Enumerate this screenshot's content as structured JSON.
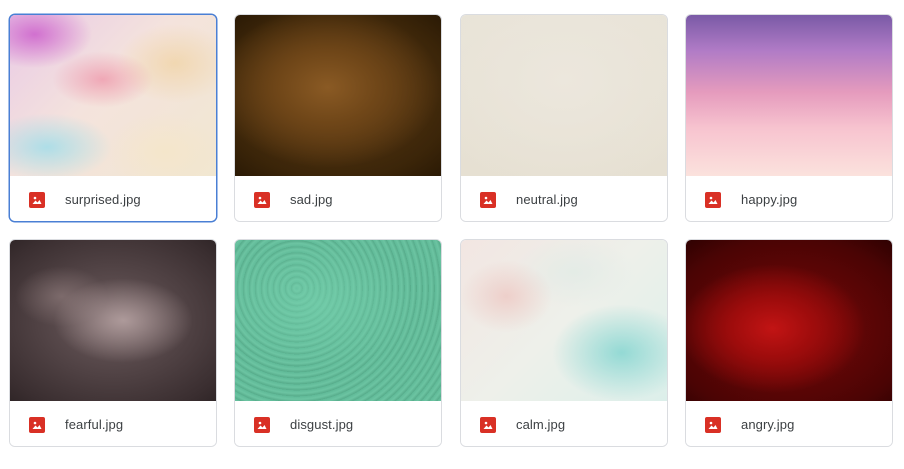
{
  "files": [
    {
      "name": "surprised.jpg",
      "type_icon": "image-file-icon",
      "selected": true
    },
    {
      "name": "sad.jpg",
      "type_icon": "image-file-icon",
      "selected": false
    },
    {
      "name": "neutral.jpg",
      "type_icon": "image-file-icon",
      "selected": false
    },
    {
      "name": "happy.jpg",
      "type_icon": "image-file-icon",
      "selected": false
    },
    {
      "name": "fearful.jpg",
      "type_icon": "image-file-icon",
      "selected": false
    },
    {
      "name": "disgust.jpg",
      "type_icon": "image-file-icon",
      "selected": false
    },
    {
      "name": "calm.jpg",
      "type_icon": "image-file-icon",
      "selected": false
    },
    {
      "name": "angry.jpg",
      "type_icon": "image-file-icon",
      "selected": false
    }
  ],
  "colors": {
    "selection_border": "#4a7fd4",
    "card_border": "#dadce0",
    "image_icon": "#d93025",
    "filename_text": "#3c4043"
  }
}
